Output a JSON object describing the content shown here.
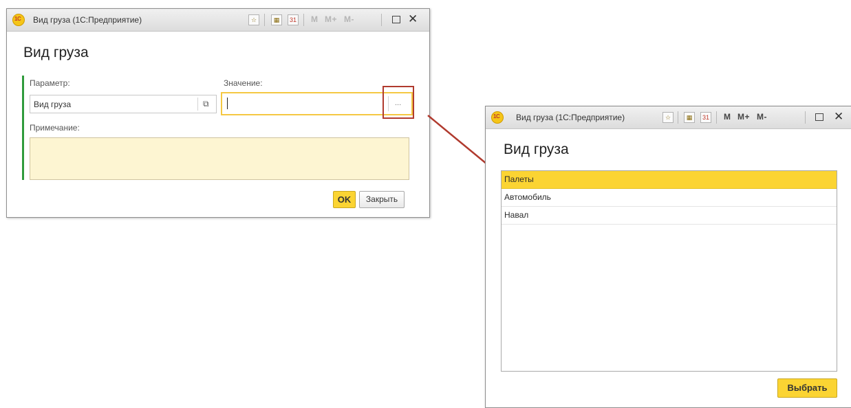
{
  "dialog1": {
    "window_title": "Вид груза  (1С:Предприятие)",
    "heading": "Вид груза",
    "param_label": "Параметр:",
    "param_value": "Вид груза",
    "value_label": "Значение:",
    "value_current": "",
    "choose_button": "...",
    "note_label": "Примечание:",
    "note_value": "",
    "ok_button": "OK",
    "close_button": "Закрыть",
    "toolbar": {
      "calendar_day": "31",
      "m": "M",
      "mplus": "M+",
      "mminus": "M-"
    }
  },
  "dialog2": {
    "window_title": "Вид груза  (1С:Предприятие)",
    "heading": "Вид груза",
    "items": [
      "Палеты",
      "Автомобиль",
      "Навал"
    ],
    "selected_index": 0,
    "select_button": "Выбрать",
    "toolbar": {
      "calendar_day": "31",
      "m": "M",
      "mplus": "M+",
      "mminus": "M-"
    }
  },
  "colors": {
    "accent_yellow": "#fbd433",
    "note_bg": "#fdf5d2",
    "active_border": "#f5c842",
    "group_bar": "#2f9b3c",
    "callout": "#b03a2e"
  },
  "logo_text": "1C"
}
